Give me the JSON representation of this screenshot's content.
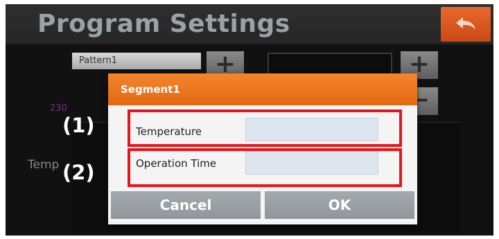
{
  "header": {
    "title": "Program Settings",
    "back_icon": "back-arrow-icon",
    "back_color": "#d95a1f"
  },
  "pattern": {
    "name": "Pattern1",
    "add_icon": "plus-icon"
  },
  "segment_controls": {
    "add_icon": "plus-icon",
    "delete_icon": "minus-icon"
  },
  "graph": {
    "temp_value": "230",
    "axis_label": "Temp"
  },
  "annotations": {
    "marker_1": "(1)",
    "marker_2": "(2)",
    "highlight_color": "#e8141a"
  },
  "dialog": {
    "title": "Segment1",
    "header_color": "#ef7a24",
    "fields": [
      {
        "label": "Temperature",
        "value": ""
      },
      {
        "label": "Operation Time",
        "value": ""
      }
    ],
    "cancel_label": "Cancel",
    "ok_label": "OK"
  }
}
